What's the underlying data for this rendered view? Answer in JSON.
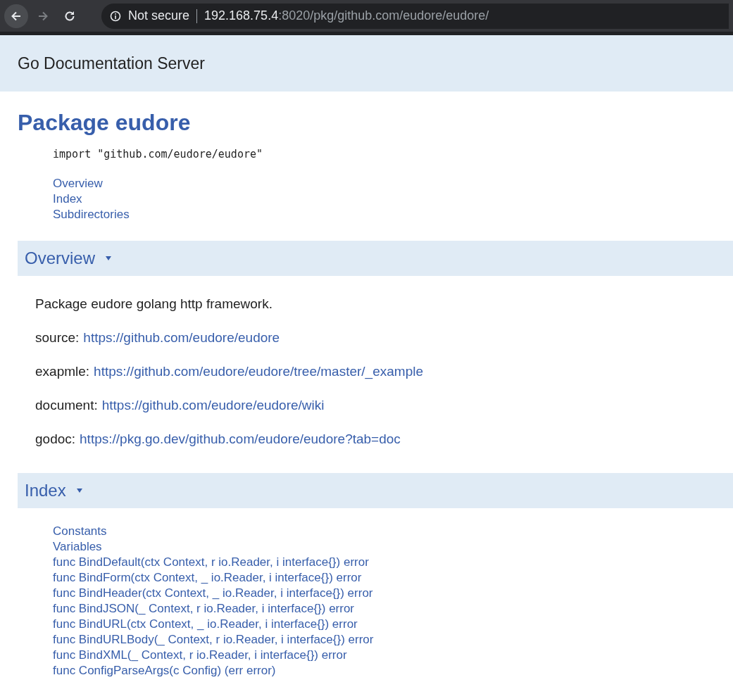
{
  "browser": {
    "security": "Not secure",
    "host": "192.168.75.4",
    "path": ":8020/pkg/github.com/eudore/eudore/"
  },
  "site_header": {
    "title": "Go Documentation Server"
  },
  "package": {
    "title": "Package eudore",
    "import": "import \"github.com/eudore/eudore\"",
    "nav": [
      "Overview",
      "Index",
      "Subdirectories"
    ]
  },
  "overview": {
    "heading": "Overview",
    "expanded": true,
    "paragraphs": [
      {
        "kind": "text",
        "text": "Package eudore golang http framework."
      },
      {
        "kind": "link",
        "label": "source:",
        "url": "https://github.com/eudore/eudore"
      },
      {
        "kind": "link",
        "label": "exapmle:",
        "url": "https://github.com/eudore/eudore/tree/master/_example"
      },
      {
        "kind": "link",
        "label": "document:",
        "url": "https://github.com/eudore/eudore/wiki"
      },
      {
        "kind": "link",
        "label": "godoc:",
        "url": "https://pkg.go.dev/github.com/eudore/eudore?tab=doc"
      }
    ]
  },
  "index": {
    "heading": "Index",
    "expanded": true,
    "items": [
      "Constants",
      "Variables",
      "func BindDefault(ctx Context, r io.Reader, i interface{}) error",
      "func BindForm(ctx Context, _ io.Reader, i interface{}) error",
      "func BindHeader(ctx Context, _ io.Reader, i interface{}) error",
      "func BindJSON(_ Context, r io.Reader, i interface{}) error",
      "func BindURL(ctx Context, _ io.Reader, i interface{}) error",
      "func BindURLBody(_ Context, r io.Reader, i interface{}) error",
      "func BindXML(_ Context, r io.Reader, i interface{}) error",
      "func ConfigParseArgs(c Config) (err error)"
    ]
  }
}
